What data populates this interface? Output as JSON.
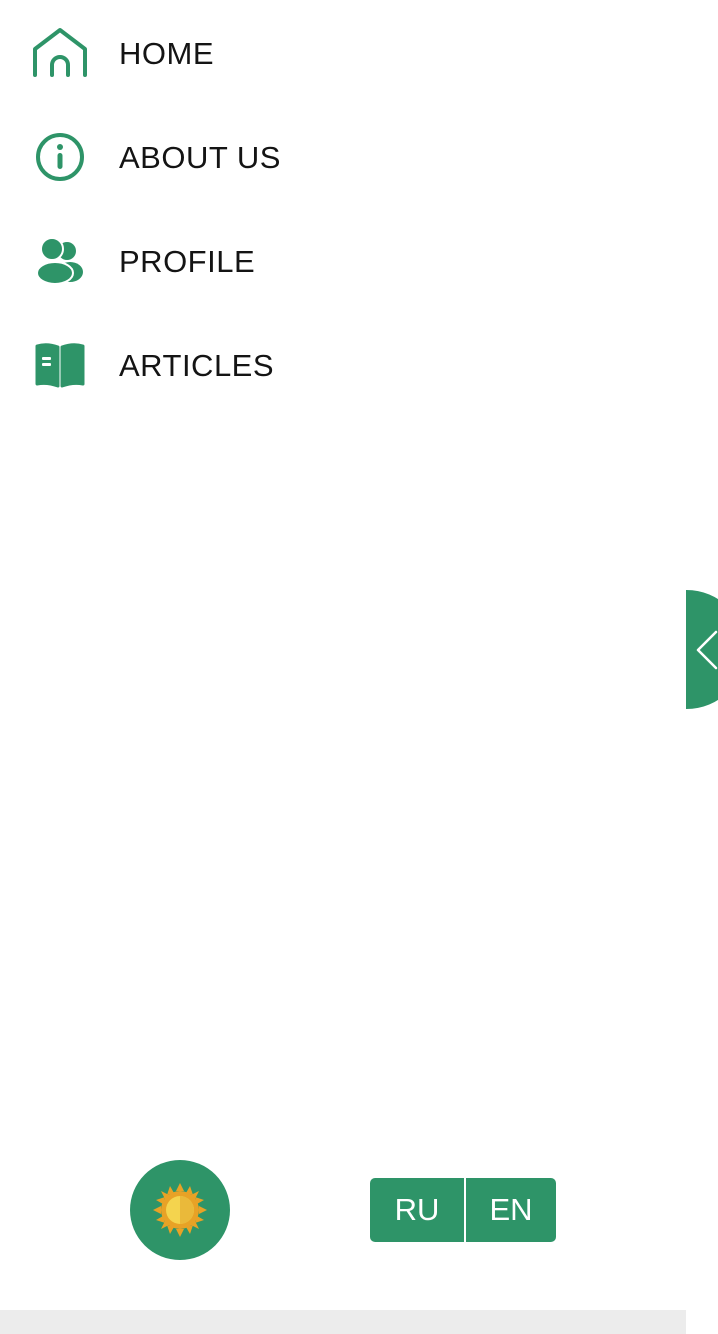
{
  "nav": {
    "items": [
      {
        "label": "HOME",
        "icon": "home-icon"
      },
      {
        "label": "ABOUT US",
        "icon": "info-icon"
      },
      {
        "label": "PROFILE",
        "icon": "users-icon"
      },
      {
        "label": "ARTICLES",
        "icon": "book-icon"
      }
    ]
  },
  "sidebar_toggle": {
    "icon": "chevron-left-icon"
  },
  "theme_toggle": {
    "icon": "sun-icon"
  },
  "language": {
    "options": [
      "RU",
      "EN"
    ]
  },
  "colors": {
    "accent": "#2e9468",
    "text": "#141414",
    "sun_outer": "#e8a226",
    "sun_inner": "#f4d44e"
  }
}
